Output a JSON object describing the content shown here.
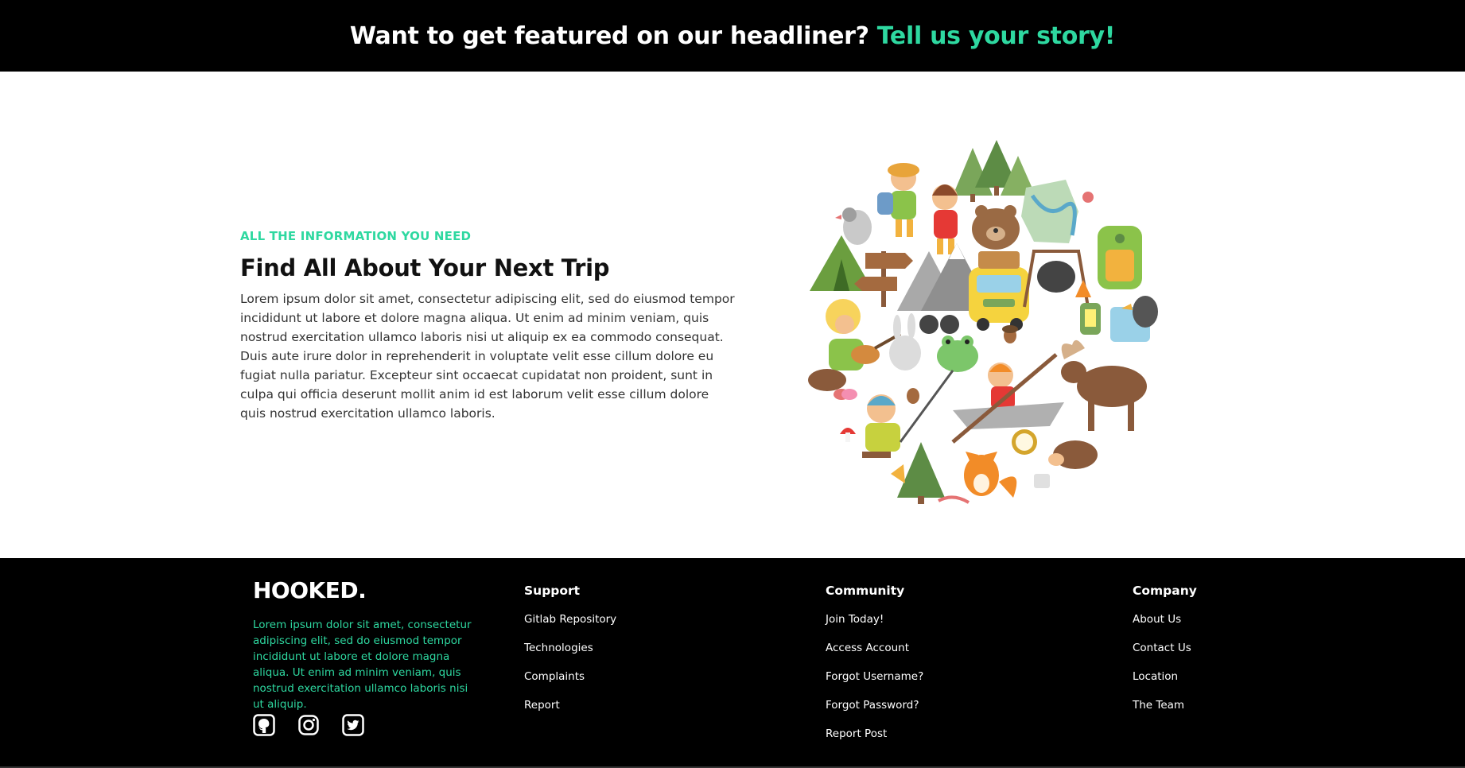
{
  "banner": {
    "text": "Want to get featured on our headliner?",
    "link": "Tell us your story!"
  },
  "hero": {
    "eyebrow": "ALL THE INFORMATION YOU NEED",
    "title": "Find All About Your Next Trip",
    "body": "Lorem ipsum dolor sit amet, consectetur adipiscing elit, sed do eiusmod tempor incididunt ut labore et dolore magna aliqua. Ut enim ad minim veniam, quis nostrud exercitation ullamco laboris nisi ut aliquip ex ea commodo consequat. Duis aute irure dolor in reprehenderit in voluptate velit esse cillum dolore eu fugiat nulla pariatur. Excepteur sint occaecat cupidatat non proident, sunt in culpa qui officia deserunt mollit anim id est laborum velit esse cillum dolore quis nostrud exercitation ullamco laboris."
  },
  "footer": {
    "brand": "HOOKED.",
    "description": "Lorem ipsum dolor sit amet, consectetur adipiscing elit, sed do eiusmod tempor incididunt ut labore et dolore magna aliqua. Ut enim ad minim veniam, quis nostrud exercitation ullamco laboris nisi ut aliquip.",
    "socials": [
      "github-icon",
      "instagram-icon",
      "twitter-icon"
    ],
    "support": {
      "title": "Support",
      "links": [
        "Gitlab Repository",
        "Technologies",
        "Complaints",
        "Report"
      ]
    },
    "community": {
      "title": "Community",
      "links": [
        "Join Today!",
        "Access Account",
        "Forgot Username?",
        "Forgot Password?",
        "Report Post"
      ]
    },
    "company": {
      "title": "Company",
      "links": [
        "About Us",
        "Contact Us",
        "Location",
        "The Team"
      ]
    }
  },
  "colors": {
    "accent": "#2ed8a0",
    "background_dark": "#000000",
    "text_light": "#ffffff"
  }
}
